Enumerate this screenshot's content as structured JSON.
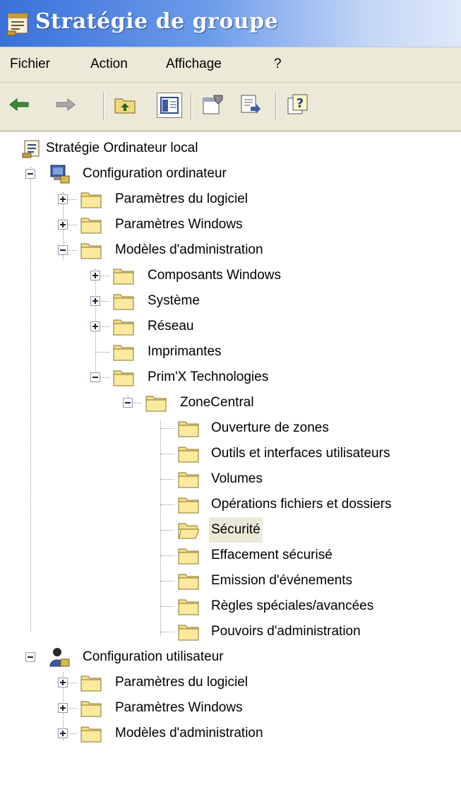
{
  "window": {
    "title": "Stratégie de groupe",
    "title_icon": "group-policy-icon"
  },
  "menu": [
    {
      "label": "Fichier"
    },
    {
      "label": "Action"
    },
    {
      "label": "Affichage"
    },
    {
      "label": "?"
    }
  ],
  "toolbar": [
    {
      "name": "back-arrow-icon"
    },
    {
      "name": "forward-arrow-icon"
    },
    {
      "name": "up-folder-icon"
    },
    {
      "name": "show-hide-tree-icon"
    },
    {
      "name": "properties-icon"
    },
    {
      "name": "export-list-icon"
    },
    {
      "name": "help-icon"
    }
  ],
  "tree": {
    "root": "Stratégie Ordinateur local",
    "computer_config": {
      "label": "Configuration ordinateur",
      "software_settings": "Paramètres du logiciel",
      "windows_settings": "Paramètres Windows",
      "admin_templates": {
        "label": "Modèles d'administration",
        "windows_components": "Composants Windows",
        "system": "Système",
        "network": "Réseau",
        "printers": "Imprimantes",
        "primx": {
          "label": "Prim'X Technologies",
          "zonecentral": {
            "label": "ZoneCentral",
            "items": [
              "Ouverture de zones",
              "Outils et interfaces utilisateurs",
              "Volumes",
              "Opérations fichiers et dossiers",
              "Sécurité",
              "Effacement sécurisé",
              "Emission d'événements",
              "Règles spéciales/avancées",
              "Pouvoirs d'administration"
            ],
            "selected": "Sécurité"
          }
        }
      }
    },
    "user_config": {
      "label": "Configuration utilisateur",
      "software_settings": "Paramètres du logiciel",
      "windows_settings": "Paramètres Windows",
      "admin_templates": "Modèles d'administration"
    }
  }
}
